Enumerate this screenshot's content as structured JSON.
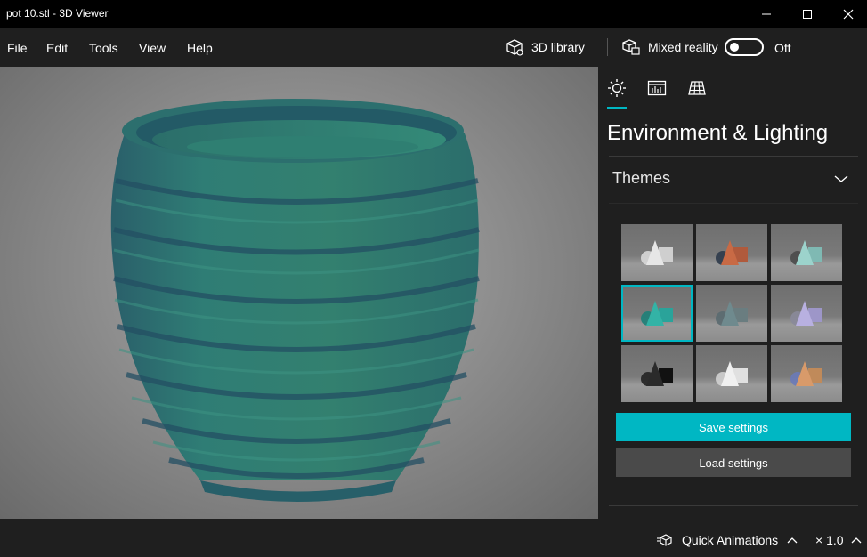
{
  "window": {
    "title": "pot 10.stl - 3D Viewer"
  },
  "menu": {
    "items": [
      "File",
      "Edit",
      "Tools",
      "View",
      "Help"
    ],
    "library_label": "3D library",
    "mixed_reality_label": "Mixed reality",
    "mixed_reality_state": "Off"
  },
  "panel": {
    "tabs": [
      "sun-icon",
      "stats-icon",
      "grid-icon"
    ],
    "heading": "Environment & Lighting",
    "themes_label": "Themes",
    "selected_theme_index": 3,
    "save_button": "Save settings",
    "load_button": "Load settings"
  },
  "statusbar": {
    "quick_animations_label": "Quick Animations",
    "speed_label": "× 1.0"
  },
  "colors": {
    "accent": "#00b7c3",
    "model": "#2e7a73"
  }
}
